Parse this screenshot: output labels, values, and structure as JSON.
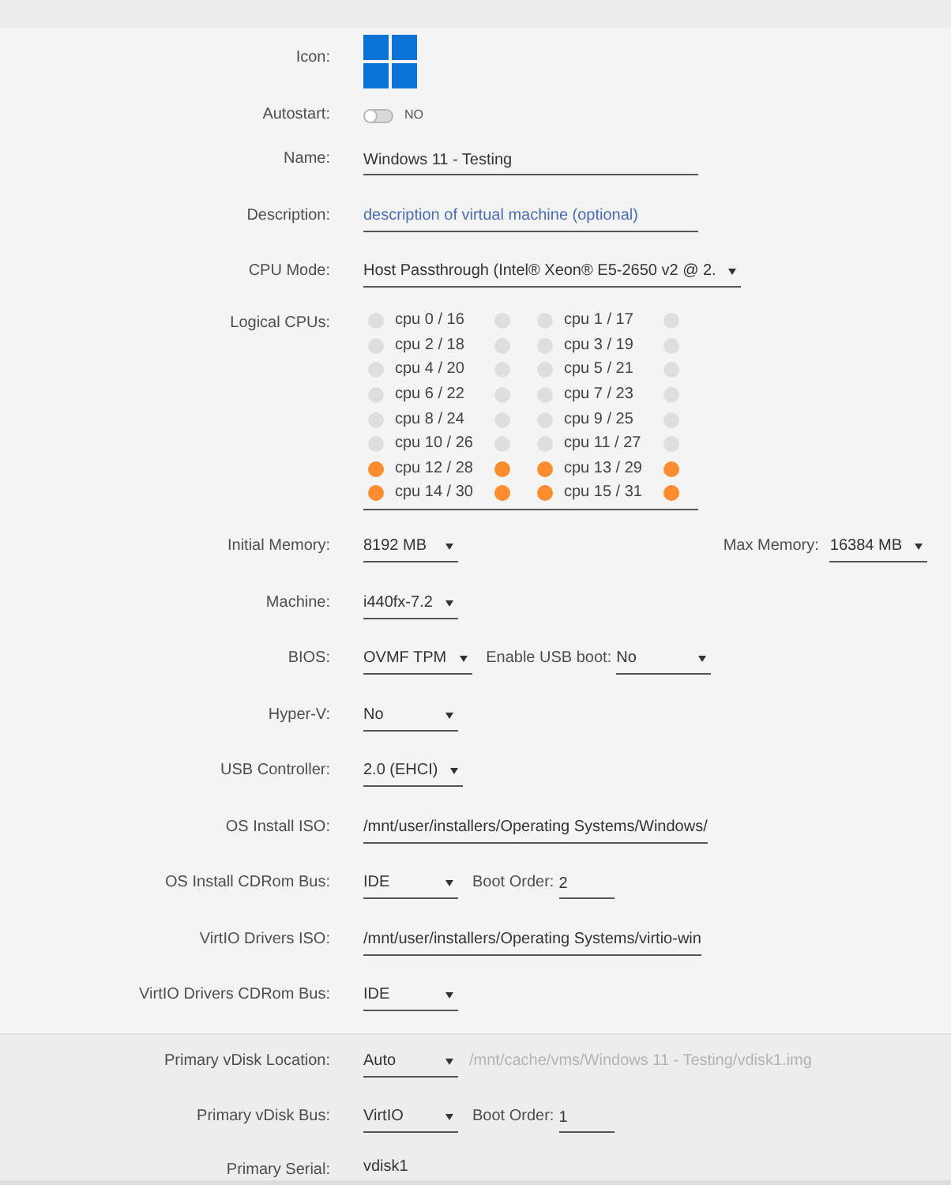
{
  "vm_settings": {
    "fields": [
      {
        "kind": "icon",
        "label": "Icon:"
      },
      {
        "kind": "toggle",
        "label": "Autostart:",
        "on": false,
        "text": "NO"
      },
      {
        "kind": "text",
        "label": "Name:",
        "value": "Windows 11 - Testing"
      },
      {
        "kind": "text",
        "label": "Description:",
        "placeholder": "description of virtual machine (optional)"
      },
      {
        "kind": "select",
        "label": "CPU Mode:",
        "value": "Host Passthrough (Intel® Xeon® E5-2650 v2 @ 2."
      },
      {
        "kind": "cpus",
        "label": "Logical CPUs:",
        "cores": [
          {
            "label": "cpu 0 / 16",
            "threads": [
              {
                "checked": false
              },
              {
                "checked": false
              }
            ]
          },
          {
            "label": "cpu 1 / 17",
            "threads": [
              {
                "checked": false
              },
              {
                "checked": false
              }
            ]
          },
          {
            "label": "cpu 2 / 18",
            "threads": [
              {
                "checked": false
              },
              {
                "checked": false
              }
            ]
          },
          {
            "label": "cpu 3 / 19",
            "threads": [
              {
                "checked": false
              },
              {
                "checked": false
              }
            ]
          },
          {
            "label": "cpu 4 / 20",
            "threads": [
              {
                "checked": false
              },
              {
                "checked": false
              }
            ]
          },
          {
            "label": "cpu 5 / 21",
            "threads": [
              {
                "checked": false
              },
              {
                "checked": false
              }
            ]
          },
          {
            "label": "cpu 6 / 22",
            "threads": [
              {
                "checked": false
              },
              {
                "checked": false
              }
            ]
          },
          {
            "label": "cpu 7 / 23",
            "threads": [
              {
                "checked": false
              },
              {
                "checked": false
              }
            ]
          },
          {
            "label": "cpu 8 / 24",
            "threads": [
              {
                "checked": false
              },
              {
                "checked": false
              }
            ]
          },
          {
            "label": "cpu 9 / 25",
            "threads": [
              {
                "checked": false
              },
              {
                "checked": false
              }
            ]
          },
          {
            "label": "cpu 10 / 26",
            "threads": [
              {
                "checked": false
              },
              {
                "checked": false
              }
            ]
          },
          {
            "label": "cpu 11 / 27",
            "threads": [
              {
                "checked": false
              },
              {
                "checked": false
              }
            ]
          },
          {
            "label": "cpu 12 / 28",
            "threads": [
              {
                "checked": true
              },
              {
                "checked": true
              }
            ]
          },
          {
            "label": "cpu 13 / 29",
            "threads": [
              {
                "checked": true
              },
              {
                "checked": true
              }
            ]
          },
          {
            "label": "cpu 14 / 30",
            "threads": [
              {
                "checked": true
              },
              {
                "checked": true
              }
            ]
          },
          {
            "label": "cpu 15 / 31",
            "threads": [
              {
                "checked": true
              },
              {
                "checked": true
              }
            ]
          }
        ]
      },
      {
        "kind": "select",
        "label": "Initial Memory:",
        "value": "8192 MB",
        "aside": {
          "label": "Max Memory:",
          "value": "16384 MB"
        }
      },
      {
        "kind": "select",
        "label": "Machine:",
        "value": "i440fx-7.2"
      },
      {
        "kind": "select",
        "label": "BIOS:",
        "value": "OVMF TPM",
        "extra": {
          "kind": "select",
          "label": "Enable USB boot:",
          "value": "No"
        }
      },
      {
        "kind": "select",
        "label": "Hyper-V:",
        "value": "No"
      },
      {
        "kind": "select",
        "label": "USB Controller:",
        "value": "2.0 (EHCI)"
      },
      {
        "kind": "path",
        "label": "OS Install ISO:",
        "value": "/mnt/user/installers/Operating Systems/Windows/"
      },
      {
        "kind": "select",
        "label": "OS Install CDRom Bus:",
        "value": "IDE",
        "extra": {
          "kind": "text",
          "label": "Boot Order:",
          "value": "2"
        }
      },
      {
        "kind": "path",
        "label": "VirtIO Drivers ISO:",
        "value": "/mnt/user/installers/Operating Systems/virtio-win"
      },
      {
        "kind": "select",
        "label": "VirtIO Drivers CDRom Bus:",
        "value": "IDE"
      }
    ]
  },
  "vdisk": {
    "fields": [
      {
        "kind": "select",
        "label": "Primary vDisk Location:",
        "value": "Auto",
        "note": "/mnt/cache/vms/Windows 11 - Testing/vdisk1.img"
      },
      {
        "kind": "select",
        "label": "Primary vDisk Bus:",
        "value": "VirtIO",
        "extra": {
          "kind": "text",
          "label": "Boot Order:",
          "value": "1"
        }
      },
      {
        "kind": "plain",
        "label": "Primary Serial:",
        "value": "vdisk1"
      }
    ]
  }
}
